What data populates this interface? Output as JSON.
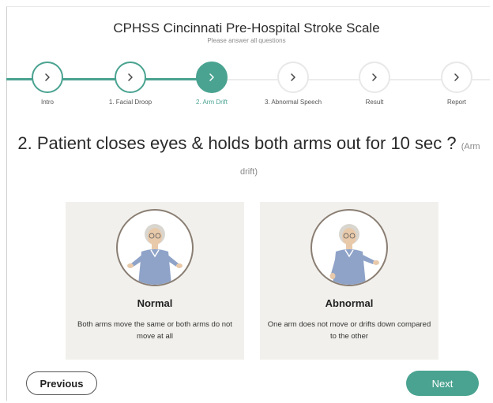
{
  "header": {
    "title": "CPHSS Cincinnati Pre-Hospital Stroke Scale",
    "subtitle": "Please answer all questions"
  },
  "steps": [
    {
      "label": "Intro",
      "state": "done"
    },
    {
      "label": "1. Facial Droop",
      "state": "done"
    },
    {
      "label": "2. Arm Drift",
      "state": "active"
    },
    {
      "label": "3. Abnormal Speech",
      "state": "todo"
    },
    {
      "label": "Result",
      "state": "todo"
    },
    {
      "label": "Report",
      "state": "todo"
    }
  ],
  "question": {
    "text": "2. Patient closes eyes & holds both arms out for 10 sec ?",
    "hint": "(Arm drift)"
  },
  "options": [
    {
      "title": "Normal",
      "description": "Both arms move the same or both arms do not move at all",
      "image_icon": "patient-arms-level-icon"
    },
    {
      "title": "Abnormal",
      "description": "One arm does not move or drifts down compared to the other",
      "image_icon": "patient-arm-drift-icon"
    }
  ],
  "buttons": {
    "previous": "Previous",
    "next": "Next"
  },
  "colors": {
    "accent": "#4aa391",
    "card_bg": "#f1f0ec",
    "inactive_circle": "#e8e8e8"
  }
}
